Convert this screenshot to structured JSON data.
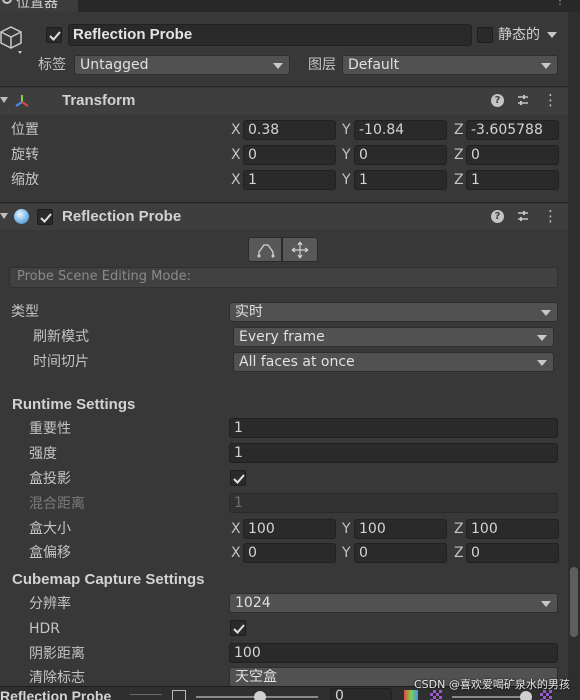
{
  "tab": {
    "title": "位置器"
  },
  "object": {
    "enabled": true,
    "name": "Reflection Probe",
    "static_label": "静态的",
    "static_checked": false,
    "tag_label": "标签",
    "tag_value": "Untagged",
    "layer_label": "图层",
    "layer_value": "Default"
  },
  "transform": {
    "title": "Transform",
    "position_label": "位置",
    "rotation_label": "旋转",
    "scale_label": "缩放",
    "axis": {
      "x": "X",
      "y": "Y",
      "z": "Z"
    },
    "position": {
      "x": "0.38",
      "y": "-10.84",
      "z": "-3.605788"
    },
    "rotation": {
      "x": "0",
      "y": "0",
      "z": "0"
    },
    "scale": {
      "x": "1",
      "y": "1",
      "z": "1"
    }
  },
  "probe": {
    "title": "Reflection Probe",
    "enabled": true,
    "edit_mode_placeholder": "Probe Scene Editing Mode:",
    "type_label": "类型",
    "type_value": "实时",
    "refresh_label": "刷新模式",
    "refresh_value": "Every frame",
    "slicing_label": "时间切片",
    "slicing_value": "All faces at once",
    "runtime_title": "Runtime Settings",
    "importance_label": "重要性",
    "importance_value": "1",
    "intensity_label": "强度",
    "intensity_value": "1",
    "box_projection_label": "盒投影",
    "box_projection_checked": true,
    "blend_distance_label": "混合距离",
    "blend_distance_value": "1",
    "box_size_label": "盒大小",
    "box_size": {
      "x": "100",
      "y": "100",
      "z": "100"
    },
    "box_offset_label": "盒偏移",
    "box_offset": {
      "x": "0",
      "y": "0",
      "z": "0"
    },
    "cubemap_title": "Cubemap Capture Settings",
    "resolution_label": "分辨率",
    "resolution_value": "1024",
    "hdr_label": "HDR",
    "hdr_checked": true,
    "shadow_distance_label": "阴影距离",
    "shadow_distance_value": "100",
    "clear_flags_label": "清除标志",
    "clear_flags_value": "天空盒"
  },
  "preview": {
    "title": "Reflection Probe",
    "value": "0"
  },
  "watermark": "CSDN @喜欢爱喝矿泉水的男孩",
  "colors": {
    "background": "#383838",
    "field": "#2a2a2a",
    "dropdown": "#515151",
    "header": "#3e3e3e",
    "text": "#c4c4c4"
  }
}
